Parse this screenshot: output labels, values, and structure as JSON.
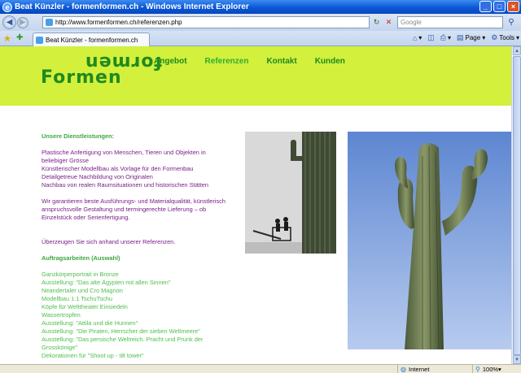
{
  "window": {
    "title": "Beat Künzler - formenformen.ch - Windows Internet Explorer",
    "buttons": [
      "_",
      "□",
      "×"
    ]
  },
  "address_bar": {
    "url": "http://www.formenformen.ch/referenzen.php",
    "search_placeholder": "Google"
  },
  "tab": {
    "label": "Beat Künzler - formenformen.ch"
  },
  "command_bar": {
    "page_label": "Page",
    "tools_label": "Tools"
  },
  "site": {
    "logo_top": "formen",
    "logo_bottom": "Formen",
    "menu": [
      "Angebot",
      "Referenzen",
      "Kontakt",
      "Kunden"
    ],
    "active_menu": "Referenzen"
  },
  "content": {
    "heading_services": "Unsere Dienstleistungen:",
    "services": [
      "Plastische Anfertigung von Menschen, Tieren und Objekten in",
      "beliebiger Grösse",
      "Künstlerischer Modellbau als Vorlage für den Formenbau",
      "Detailgetreue Nachbildung von Originalen",
      "Nachbau von realen Raumsituationen und historischen Stätten"
    ],
    "guarantee": [
      "Wir garantieren beste Ausführungs- und Materialqualität, künstlerisch",
      "anspruchsvolle Gestaltung und termingerechte Lieferung – ob",
      "Einzelstück oder Serienfertigung."
    ],
    "convince": "Überzeugen Sie sich anhand unserer Referenzen.",
    "heading_orders": "Auftragsarbeiten (Auswahl)",
    "references": [
      "Ganzkörperportrait in Bronze",
      "Ausstellung: \"Das alte Ägypten mit allen Sinnen\"",
      "Neandertaler und Cro Magnon",
      "Modellbau 1:1 TschuTschu",
      "Köpfe für Welttheater Einsiedeln",
      "Wassertropfen",
      "Ausstellung: \"Attila und die Hunnen\"",
      "Ausstellung: \"Die Piraten, Herrscher der sieben Weltmeere\"",
      "Ausstellung: \"Das persische Weltreich. Pracht und Prunk der",
      "Grosskönige\"",
      "Dekorationen für \"Shoot up - tilt tower\""
    ]
  },
  "status_bar": {
    "zone": "Internet",
    "zoom": "100%"
  },
  "colors": {
    "header_bg": "#d2f03c",
    "brand_green": "#1f8a1f",
    "text_purple": "#7a1f8a",
    "link_green": "#4cbf4c"
  }
}
